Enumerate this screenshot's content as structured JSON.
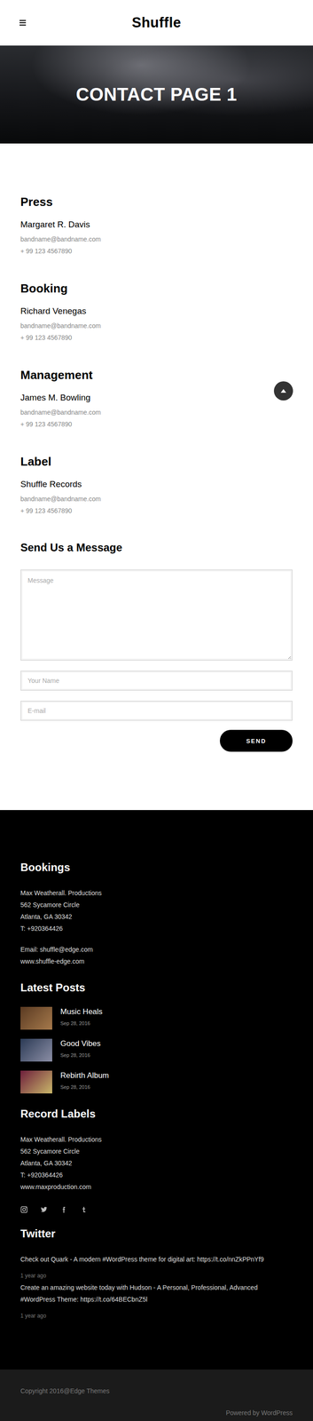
{
  "header": {
    "title": "Shuffle"
  },
  "hero": {
    "title": "CONTACT PAGE 1"
  },
  "contacts": [
    {
      "heading": "Press",
      "name": "Margaret R. Davis",
      "email": "bandname@bandname.com",
      "phone": "+ 99 123 4567890"
    },
    {
      "heading": "Booking",
      "name": "Richard Venegas",
      "email": "bandname@bandname.com",
      "phone": "+ 99 123 4567890"
    },
    {
      "heading": "Management",
      "name": "James M. Bowling",
      "email": "bandname@bandname.com",
      "phone": "+ 99 123 4567890"
    },
    {
      "heading": "Label",
      "name": "Shuffle Records",
      "email": "bandname@bandname.com",
      "phone": "+ 99 123 4567890"
    }
  ],
  "form": {
    "heading": "Send Us a Message",
    "message_placeholder": "Message",
    "name_placeholder": "Your Name",
    "email_placeholder": "E-mail",
    "button": "SEND"
  },
  "footer": {
    "bookings": {
      "heading": "Bookings",
      "address": [
        "Max Weatherall. Productions",
        "562 Sycamore Circle",
        "Atlanta, GA 30342",
        "T: +920364426"
      ],
      "contact": [
        "Email: shuffle@edge.com",
        "www.shuffle-edge.com"
      ]
    },
    "latest_posts": {
      "heading": "Latest Posts",
      "posts": [
        {
          "title": "Music Heals",
          "date": "Sep 28, 2016"
        },
        {
          "title": "Good Vibes",
          "date": "Sep 28, 2016"
        },
        {
          "title": "Rebirth Album",
          "date": "Sep 28, 2016"
        }
      ]
    },
    "record_labels": {
      "heading": "Record Labels",
      "lines": [
        "Max Weatherall. Productions",
        "562 Sycamore Circle",
        "Atlanta, GA 30342",
        "T: +920364426",
        "www.maxproduction.com"
      ]
    },
    "twitter": {
      "heading": "Twitter",
      "tweets": [
        {
          "text": "Check out Quark - A modern #WordPress theme for digital art: https://t.co/nnZkPPnYf9",
          "time": "1 year ago"
        },
        {
          "text": "Create an amazing website today with Hudson - A Personal, Professional, Advanced #WordPress Theme: https://t.co/64BECbnZ5l",
          "time": "1 year ago"
        }
      ]
    }
  },
  "bottom_bar": {
    "copyright": "Copyright 2016@Edge Themes",
    "powered_by": "Powered by WordPress"
  }
}
